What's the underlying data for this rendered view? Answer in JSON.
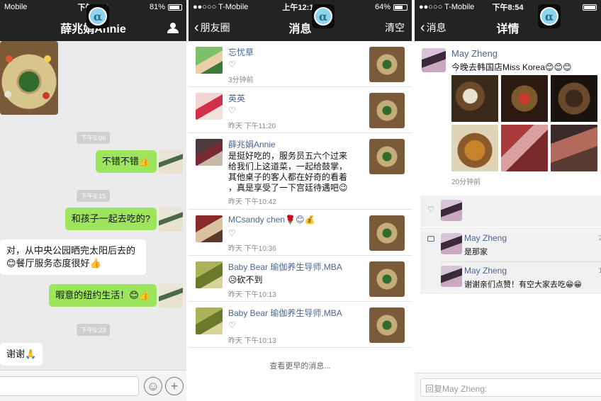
{
  "panel1": {
    "status": {
      "carrier": "Mobile",
      "time": "下午8:20",
      "battery": "81%",
      "battery_level": 0.81
    },
    "nav": {
      "title": "薛兆娟Annie"
    },
    "alpha_badge": "α",
    "messages": [
      {
        "type": "time",
        "text": "下午5:06"
      },
      {
        "type": "out",
        "text": "不错不错👍"
      },
      {
        "type": "time",
        "text": "下午5:15"
      },
      {
        "type": "out",
        "text": "和孩子一起去吃的?"
      },
      {
        "type": "in",
        "line1": "对，从中央公园晒完太阳后去的",
        "line2": "😊餐厅服务态度很好👍"
      },
      {
        "type": "out",
        "text": "暇意的纽约生活！😊👍"
      },
      {
        "type": "time",
        "text": "下午5:23"
      },
      {
        "type": "in",
        "text": "谢谢🙏"
      }
    ],
    "input": {
      "emoji_icon": "☺",
      "plus_icon": "+"
    }
  },
  "panel2": {
    "status": {
      "carrier": "●●○○○ T-Mobile",
      "time": "上午12:12",
      "battery": "64%",
      "battery_level": 0.64
    },
    "nav": {
      "back_label": "朋友圈",
      "title": "消息",
      "right_label": "清空"
    },
    "alpha_badge": "α",
    "rows": [
      {
        "name": "忘忧草",
        "heart": "♡",
        "time": "3分钟前"
      },
      {
        "name": "英英",
        "heart": "♡",
        "time": "昨天 下午11:20"
      },
      {
        "name": "薛兆娟Annie",
        "lines": [
          "是挺好吃的，服务员五六个过来",
          "给我们上这道菜，一起给鼓掌，",
          "其他桌子的客人都在好奇的看着",
          "，真是享受了一下宫廷待遇吧😉"
        ],
        "time": "昨天 下午10:42"
      },
      {
        "name": "MCsandy chen🌹😊💰",
        "heart": "♡",
        "time": "昨天 下午10:36"
      },
      {
        "name": "Baby Bear 瑜伽养生导师,MBA",
        "text": "😥砍不到",
        "time": "昨天 下午10:13"
      },
      {
        "name": "Baby Bear 瑜伽养生导师,MBA",
        "heart": "♡",
        "time": "昨天 下午10:13"
      }
    ],
    "more": "查看更早的消息..."
  },
  "panel3": {
    "status": {
      "carrier": "●●○○○ T-Mobile",
      "time": "下午8:54",
      "battery": "",
      "battery_level": 0.9
    },
    "nav": {
      "back_label": "消息",
      "title": "详情"
    },
    "alpha_badge": "α",
    "post": {
      "name": "May Zheng",
      "text": "今晚去韩国店Miss Korea😊😊😊",
      "time": "20分钟前"
    },
    "likes_icon": "♡",
    "comments": [
      {
        "name": "May Zheng",
        "text": "是那家",
        "time": "2"
      },
      {
        "name": "May Zheng",
        "text": "谢谢亲们点赞！有空大家去吃😁😁",
        "time": "1"
      }
    ],
    "reply_placeholder": "回复May Zheng:"
  },
  "colors": {
    "nav_bg": "#232323",
    "bubble_out": "#9ee55e",
    "link_blue": "#4a6592"
  }
}
